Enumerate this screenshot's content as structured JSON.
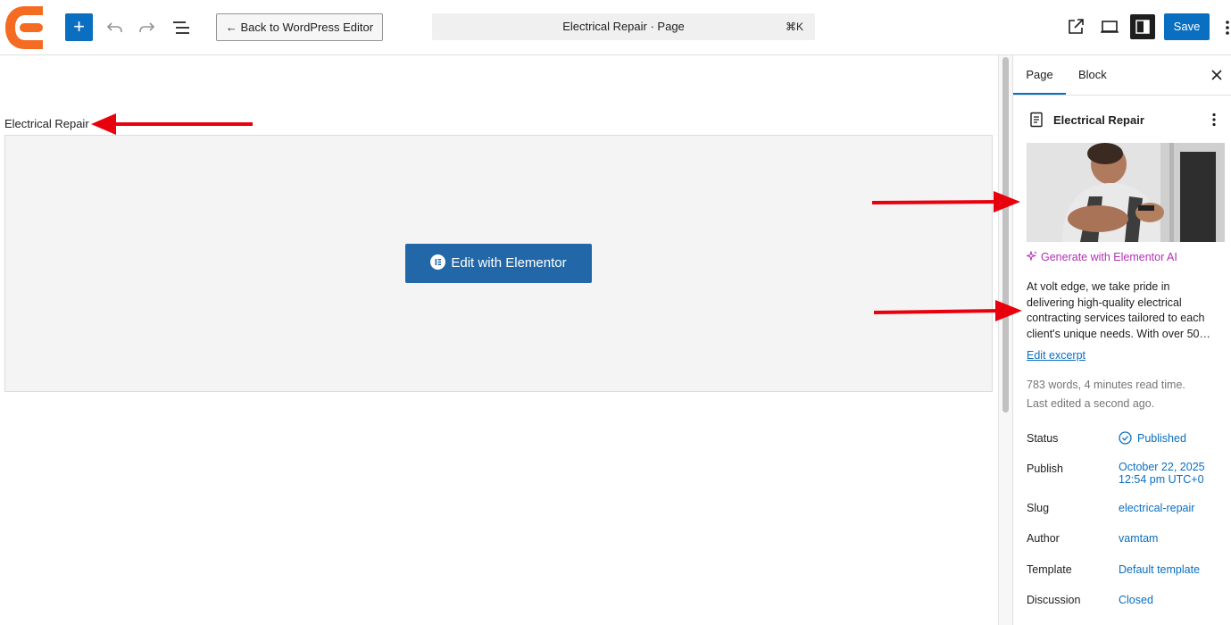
{
  "toolbar": {
    "back_label": "← Back to WordPress Editor",
    "command_title": "Electrical Repair · Page",
    "command_shortcut": "⌘K",
    "save_label": "Save",
    "add_label": "+"
  },
  "canvas": {
    "page_title": "Electrical Repair",
    "edit_button_label": "Edit with Elementor"
  },
  "sidebar": {
    "tabs": [
      "Page",
      "Block"
    ],
    "document_title": "Electrical Repair",
    "generate_ai_label": "Generate with Elementor AI",
    "excerpt_lines": [
      "At volt edge, we take pride in",
      "delivering high-quality electrical",
      "contracting services tailored to each",
      "client's unique needs. With over 50…"
    ],
    "edit_excerpt_label": "Edit excerpt",
    "word_count": "783 words, 4 minutes read time.",
    "last_edited": "Last edited a second ago.",
    "rows": [
      {
        "label": "Status",
        "value": "Published"
      },
      {
        "label": "Publish",
        "value": "October 22, 2025",
        "value2": "12:54 pm UTC+0"
      },
      {
        "label": "Slug",
        "value": "electrical-repair"
      },
      {
        "label": "Author",
        "value": "vamtam"
      },
      {
        "label": "Template",
        "value": "Default template"
      },
      {
        "label": "Discussion",
        "value": "Closed"
      }
    ]
  },
  "colors": {
    "accent": "#0a6fc0",
    "elementor_orange": "#f36c21",
    "ai_magenta": "#b32fb4",
    "annotation_red": "#e8000d"
  }
}
